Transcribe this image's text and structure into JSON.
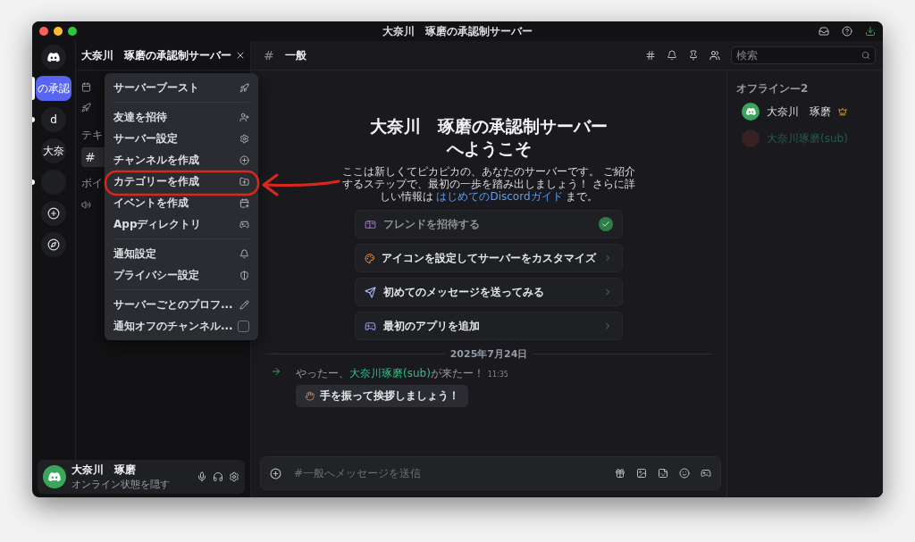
{
  "window": {
    "title": "大奈川　琢磨の承認制サーバー"
  },
  "server_rail": {
    "servers": [
      {
        "label": "の承認",
        "selected": true,
        "unread": false
      },
      {
        "label": "d",
        "selected": false,
        "unread": true
      },
      {
        "label": "大奈",
        "selected": false,
        "unread": false
      },
      {
        "selected": false,
        "unread": true
      }
    ]
  },
  "channel_sidebar": {
    "server_name": "大奈川　琢磨の承認制サーバー",
    "text_category": "テキ",
    "channel_symbol": "#",
    "voice_category": "ボイ"
  },
  "server_menu": {
    "groups": [
      [
        {
          "label": "サーバーブースト",
          "kind": "action"
        }
      ],
      [
        {
          "label": "友達を招待",
          "kind": "action"
        },
        {
          "label": "サーバー設定",
          "kind": "action"
        },
        {
          "label": "チャンネルを作成",
          "kind": "action"
        },
        {
          "label": "カテゴリーを作成",
          "kind": "action"
        },
        {
          "label": "イベントを作成",
          "kind": "action"
        },
        {
          "label": "Appディレクトリ",
          "kind": "action"
        }
      ],
      [
        {
          "label": "通知設定",
          "kind": "action"
        },
        {
          "label": "プライバシー設定",
          "kind": "action"
        }
      ],
      [
        {
          "label": "サーバーごとのプロフ...",
          "kind": "action"
        },
        {
          "label": "通知オフのチャンネル...",
          "kind": "toggle",
          "checked": false
        }
      ]
    ]
  },
  "user_panel": {
    "name": "大奈川　琢磨",
    "status": "オンライン状態を隠す"
  },
  "channel_header": {
    "symbol": "#",
    "name": "一般",
    "search_placeholder": "検索"
  },
  "welcome": {
    "title": "大奈川　琢磨の承認制サーバーへようこそ",
    "text_before": "ここは新しくてピカピカの、あなたのサーバーです。 ご紹介するステップで、最初の一歩を踏み出しましょう！ さらに詳しい情報は ",
    "link": "はじめてのDiscordガイド",
    "text_after": " まで。"
  },
  "setup_cards": [
    {
      "label": "フレンドを招待する",
      "completed": true
    },
    {
      "label": "アイコンを設定してサーバーをカスタマイズ",
      "completed": false
    },
    {
      "label": "初めてのメッセージを送ってみる",
      "completed": false
    },
    {
      "label": "最初のアプリを追加",
      "completed": false
    }
  ],
  "date_divider": "2025年7月24日",
  "join_message": {
    "before": "やったー、",
    "user": "大奈川琢磨(sub)",
    "after": "が来たー！",
    "time": "11:35",
    "wave_button": "手を振って挨拶しましょう！"
  },
  "composer": {
    "placeholder": "#一般へメッセージを送信"
  },
  "members": {
    "heading": "オフライン—2",
    "list": [
      {
        "name": "大奈川　琢磨",
        "owner": true,
        "dimmed": false
      },
      {
        "name": "大奈川琢磨(sub)",
        "owner": false,
        "dimmed": true
      }
    ]
  }
}
